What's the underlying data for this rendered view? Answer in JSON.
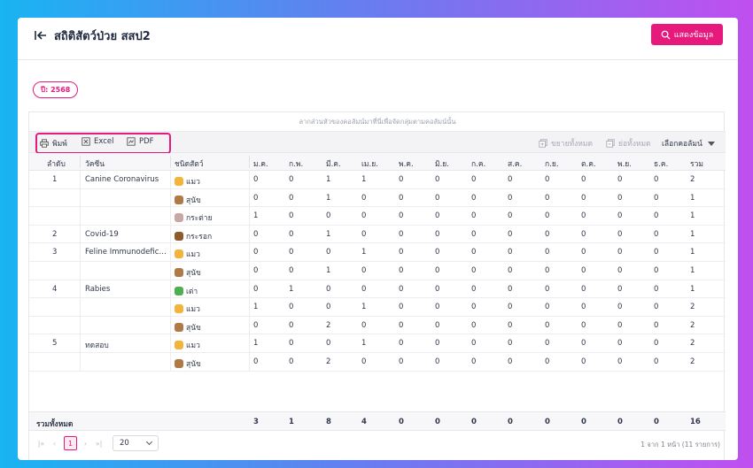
{
  "header": {
    "title": "สถิติสัตว์ป่วย สสป2",
    "show_button": "แสดงข้อมูล"
  },
  "filter": {
    "year_badge": "ปี: 2568"
  },
  "grid": {
    "group_hint": "ลากส่วนหัวของคอลัมน์มาที่นี่เพื่อจัดกลุ่มตามคอลัมน์นั้น",
    "toolbar": {
      "print": "พิมพ์",
      "excel": "Excel",
      "pdf": "PDF",
      "expand_all": "ขยายทั้งหมด",
      "collapse_all": "ย่อทั้งหมด",
      "choose_columns": "เลือกคอลัมน์"
    },
    "columns": [
      "ลำดับ",
      "วัคซีน",
      "ชนิดสัตว์",
      "ม.ค.",
      "ก.พ.",
      "มี.ค.",
      "เม.ย.",
      "พ.ค.",
      "มิ.ย.",
      "ก.ค.",
      "ส.ค.",
      "ก.ย.",
      "ต.ค.",
      "พ.ย.",
      "ธ.ค.",
      "รวม"
    ],
    "rows": [
      {
        "no": "1",
        "vaccine": "Canine Coronavirus",
        "species": "แมว",
        "icon": "cat-icon",
        "v": [
          "0",
          "0",
          "1",
          "1",
          "0",
          "0",
          "0",
          "0",
          "0",
          "0",
          "0",
          "0",
          "2"
        ]
      },
      {
        "no": "",
        "vaccine": "",
        "species": "สุนัข",
        "icon": "dog-icon",
        "v": [
          "0",
          "0",
          "1",
          "0",
          "0",
          "0",
          "0",
          "0",
          "0",
          "0",
          "0",
          "0",
          "1"
        ]
      },
      {
        "no": "",
        "vaccine": "",
        "species": "กระต่าย",
        "icon": "rabbit-icon",
        "v": [
          "1",
          "0",
          "0",
          "0",
          "0",
          "0",
          "0",
          "0",
          "0",
          "0",
          "0",
          "0",
          "1"
        ]
      },
      {
        "no": "2",
        "vaccine": "Covid-19",
        "species": "กระรอก",
        "icon": "squirrel-icon",
        "v": [
          "0",
          "0",
          "1",
          "0",
          "0",
          "0",
          "0",
          "0",
          "0",
          "0",
          "0",
          "0",
          "1"
        ]
      },
      {
        "no": "3",
        "vaccine": "Feline Immunodeficiency Virus",
        "species": "แมว",
        "icon": "cat-icon",
        "v": [
          "0",
          "0",
          "0",
          "1",
          "0",
          "0",
          "0",
          "0",
          "0",
          "0",
          "0",
          "0",
          "1"
        ]
      },
      {
        "no": "",
        "vaccine": "",
        "species": "สุนัข",
        "icon": "dog-icon",
        "v": [
          "0",
          "0",
          "1",
          "0",
          "0",
          "0",
          "0",
          "0",
          "0",
          "0",
          "0",
          "0",
          "1"
        ]
      },
      {
        "no": "4",
        "vaccine": "Rabies",
        "species": "เต่า",
        "icon": "turtle-icon",
        "v": [
          "0",
          "1",
          "0",
          "0",
          "0",
          "0",
          "0",
          "0",
          "0",
          "0",
          "0",
          "0",
          "1"
        ]
      },
      {
        "no": "",
        "vaccine": "",
        "species": "แมว",
        "icon": "cat-icon",
        "v": [
          "1",
          "0",
          "0",
          "1",
          "0",
          "0",
          "0",
          "0",
          "0",
          "0",
          "0",
          "0",
          "2"
        ]
      },
      {
        "no": "",
        "vaccine": "",
        "species": "สุนัข",
        "icon": "dog-icon",
        "v": [
          "0",
          "0",
          "2",
          "0",
          "0",
          "0",
          "0",
          "0",
          "0",
          "0",
          "0",
          "0",
          "2"
        ]
      },
      {
        "no": "5",
        "vaccine": "ทดสอบ",
        "species": "แมว",
        "icon": "cat-icon",
        "v": [
          "1",
          "0",
          "0",
          "1",
          "0",
          "0",
          "0",
          "0",
          "0",
          "0",
          "0",
          "0",
          "2"
        ]
      },
      {
        "no": "",
        "vaccine": "",
        "species": "สุนัข",
        "icon": "dog-icon",
        "v": [
          "0",
          "0",
          "2",
          "0",
          "0",
          "0",
          "0",
          "0",
          "0",
          "0",
          "0",
          "0",
          "2"
        ]
      }
    ],
    "footer": {
      "label": "รวมทั้งหมด",
      "values": [
        "3",
        "1",
        "8",
        "4",
        "0",
        "0",
        "0",
        "0",
        "0",
        "0",
        "0",
        "0",
        "16"
      ]
    },
    "pager": {
      "current_page": "1",
      "page_size": "20",
      "info": "1 จาก 1 หน้า (11 รายการ)"
    }
  },
  "colors": {
    "accent": "#e8197d",
    "text": "#30384a"
  }
}
